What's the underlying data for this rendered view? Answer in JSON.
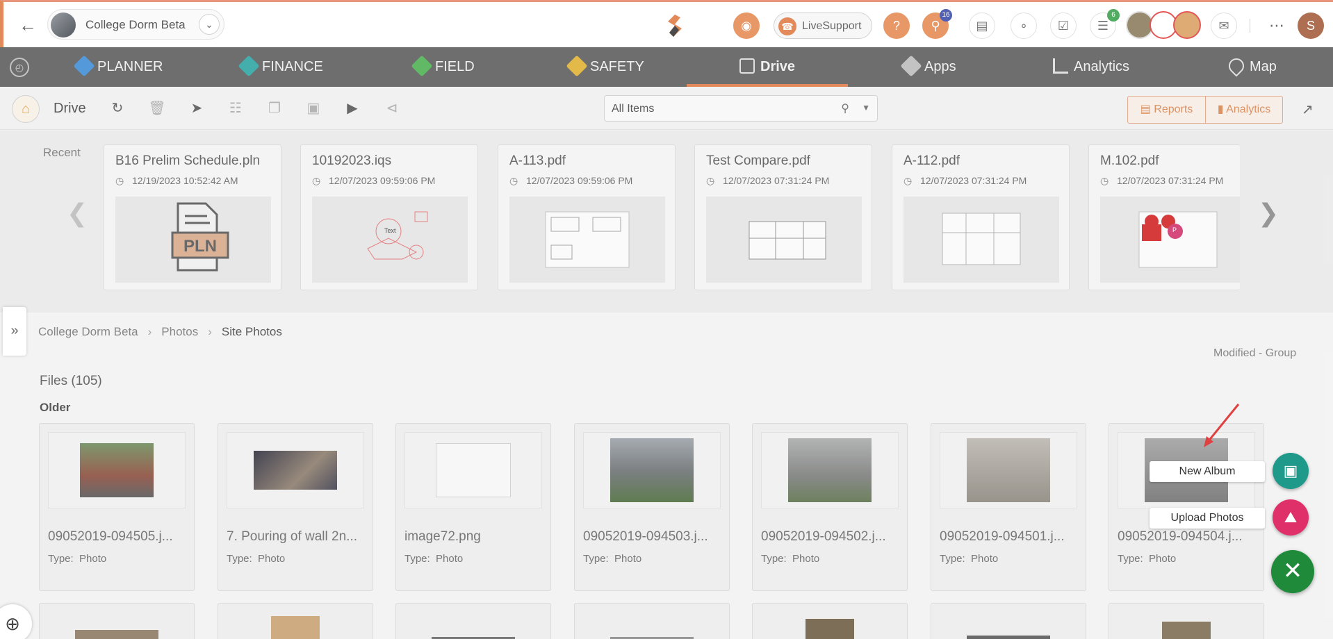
{
  "topbar": {
    "project_name": "College Dorm Beta",
    "livesupport_label": "LiveSupport",
    "notifications_count": "16",
    "cart_count": "6",
    "user_initial": "S"
  },
  "modules": [
    {
      "label": "PLANNER",
      "color": "#3d8bd4"
    },
    {
      "label": "FINANCE",
      "color": "#2aa3a0"
    },
    {
      "label": "FIELD",
      "color": "#4caf50"
    },
    {
      "label": "SAFETY",
      "color": "#e0b030"
    },
    {
      "label": "Drive",
      "color": "#cccccc"
    },
    {
      "label": "Apps",
      "color": "#cccccc"
    },
    {
      "label": "Analytics",
      "color": "#cccccc"
    },
    {
      "label": "Map",
      "color": "#cccccc"
    }
  ],
  "toolbar": {
    "title": "Drive",
    "search_value": "All Items",
    "reports_label": "Reports",
    "analytics_label": "Analytics"
  },
  "recent": {
    "label": "Recent",
    "items": [
      {
        "name": "B16 Prelim Schedule.pln",
        "date": "12/19/2023 10:52:42 AM"
      },
      {
        "name": "10192023.iqs",
        "date": "12/07/2023 09:59:06 PM"
      },
      {
        "name": "A-113.pdf",
        "date": "12/07/2023 09:59:06 PM"
      },
      {
        "name": "Test Compare.pdf",
        "date": "12/07/2023 07:31:24 PM"
      },
      {
        "name": "A-112.pdf",
        "date": "12/07/2023 07:31:24 PM"
      },
      {
        "name": "M.102.pdf",
        "date": "12/07/2023 07:31:24 PM"
      }
    ],
    "pln_label": "PLN",
    "text_label": "Text",
    "p_label": "P"
  },
  "breadcrumb": {
    "items": [
      "College Dorm Beta",
      "Photos",
      "Site Photos"
    ]
  },
  "sort_label": "Modified - Group",
  "files": {
    "title": "Files (105)",
    "group": "Older",
    "type_prefix": "Type:",
    "items": [
      {
        "name": "09052019-094505.j...",
        "type": "Photo"
      },
      {
        "name": "7. Pouring of wall 2n...",
        "type": "Photo"
      },
      {
        "name": "image72.png",
        "type": "Photo"
      },
      {
        "name": "09052019-094503.j...",
        "type": "Photo"
      },
      {
        "name": "09052019-094502.j...",
        "type": "Photo"
      },
      {
        "name": "09052019-094501.j...",
        "type": "Photo"
      },
      {
        "name": "09052019-094504.j...",
        "type": "Photo"
      }
    ]
  },
  "fab": {
    "new_album_label": "New Album",
    "upload_photos_label": "Upload Photos",
    "new_album_color": "#1f9a8a",
    "upload_color": "#e0306a",
    "main_color": "#1e8a3a"
  }
}
